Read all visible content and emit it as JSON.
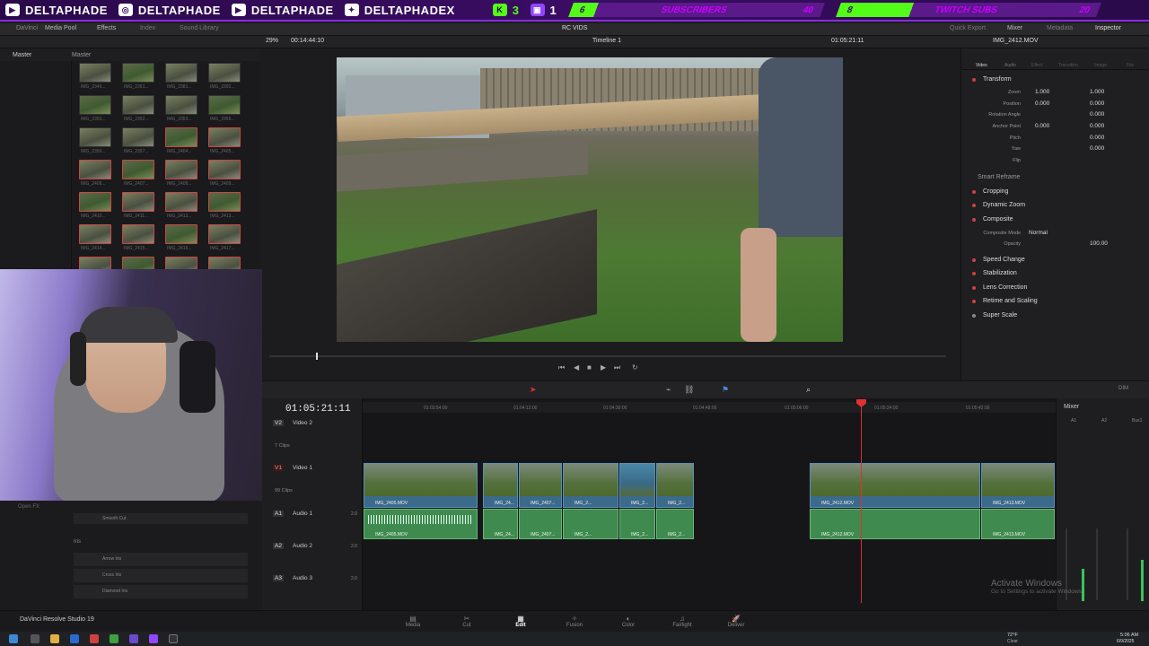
{
  "overlay": {
    "brand": "DELTAPHADE",
    "brand_x": "DELTAPHADEX",
    "kick_count": "3",
    "twitch_count": "1",
    "subs_left": "6",
    "subs_label": "SUBSCRIBERS",
    "subs_total": "40",
    "twitch_left": "8",
    "twitch_label": "TWITCH SUBS",
    "twitch_total": "20"
  },
  "toolbar": {
    "app": "DaVinci",
    "media_pool": "Media Pool",
    "effects": "Effects",
    "index": "Index",
    "sound_library": "Sound Library",
    "project_title": "RC VIDS",
    "quick_export": "Quick Export",
    "mixer": "Mixer",
    "metadata": "Metadata",
    "inspector": "Inspector"
  },
  "subbar": {
    "zoom": "29%",
    "src_timecode": "00:14:44:10",
    "timeline_name": "Timeline 1",
    "rec_timecode": "01:05:21:11",
    "clip_name": "IMG_2412.MOV"
  },
  "media": {
    "bin_master": "Master",
    "grid_master": "Master",
    "thumb_labels": [
      "IMG_2346...",
      "IMG_2361...",
      "IMG_2381...",
      "IMG_2392...",
      "IMG_2350...",
      "IMG_2352...",
      "IMG_2353...",
      "IMG_2355...",
      "IMG_2356...",
      "IMG_2357...",
      "IMG_2404...",
      "IMG_2405...",
      "IMG_2406...",
      "IMG_2407...",
      "IMG_2408...",
      "IMG_2409...",
      "IMG_2410...",
      "IMG_2411...",
      "IMG_2412...",
      "IMG_2413...",
      "IMG_2414...",
      "IMG_2415...",
      "IMG_2416...",
      "IMG_2417...",
      "IMG_2418...",
      "IMG_2419...",
      "IMG_2420...",
      "IMG_2421..."
    ]
  },
  "fx": {
    "open_fx": "Open FX",
    "smooth_cut": "Smooth Cut",
    "iris": "Iris",
    "arrow_iris": "Arrow Iris",
    "cross_iris": "Cross Iris",
    "diamond_iris": "Diamond Iris"
  },
  "inspector": {
    "tabs": [
      "Video",
      "Audio",
      "Effect",
      "Transition",
      "Image",
      "File"
    ],
    "transform": "Transform",
    "zoom_label": "Zoom",
    "zoom_x": "1.000",
    "zoom_y": "1.000",
    "position_label": "Position",
    "pos_x": "0.000",
    "pos_y": "0.000",
    "rotation_label": "Rotation Angle",
    "rotation": "0.000",
    "anchor_label": "Anchor Point",
    "anchor_x": "0.000",
    "anchor_y": "0.000",
    "pitch_label": "Pitch",
    "pitch": "0.000",
    "yaw_label": "Yaw",
    "yaw": "0.000",
    "flip_label": "Flip",
    "smart_reframe": "Smart Reframe",
    "cropping": "Cropping",
    "dynamic_zoom": "Dynamic Zoom",
    "composite": "Composite",
    "composite_mode_label": "Composite Mode",
    "composite_mode": "Normal",
    "opacity_label": "Opacity",
    "opacity": "100.00",
    "speed_change": "Speed Change",
    "stabilization": "Stabilization",
    "lens_correction": "Lens Correction",
    "retime_scaling": "Retime and Scaling",
    "super_scale": "Super Scale"
  },
  "timeline": {
    "timecode": "01:05:21:11",
    "ruler": [
      "01:03:54:00",
      "01:04:12:00",
      "01:04:30:00",
      "01:04:48:00",
      "01:05:06:00",
      "01:05:24:00",
      "01:05:42:00"
    ],
    "tracks": {
      "v2_id": "V2",
      "v2_name": "Video 2",
      "v2_clips": "7 Clips",
      "v1_id": "V1",
      "v1_name": "Video 1",
      "v1_clips": "99 Clips",
      "a1_id": "A1",
      "a1_name": "Audio 1",
      "a1_level": "2.0",
      "a2_id": "A2",
      "a2_name": "Audio 2",
      "a2_level": "2.0",
      "a3_id": "A3",
      "a3_name": "Audio 3",
      "a3_level": "2.0"
    },
    "clip_labels": {
      "c1": "IMG_2405.MOV",
      "c2": "IMG_24...",
      "c3": "IMG_2407...",
      "c4": "IMG_2...",
      "c5": "IMG_2...",
      "c6": "IMG_2...",
      "c7": "IMG_2412.MOV",
      "c8": "IMG_2413.MOV"
    },
    "mixer": "Mixer",
    "mixer_a1": "A1",
    "mixer_a2": "A2",
    "mixer_bus": "Bus1",
    "dim": "DIM"
  },
  "pages": {
    "app_name": "DaVinci Resolve Studio 19",
    "items": [
      "Media",
      "Cut",
      "Edit",
      "Fusion",
      "Color",
      "Fairlight",
      "Deliver"
    ],
    "active": "Edit"
  },
  "watermark": {
    "title": "Activate Windows",
    "subtitle": "Go to Settings to activate Windows."
  },
  "taskbar": {
    "temp": "72°F",
    "weather": "Clear",
    "time": "5:06 AM",
    "date": "6/9/2025"
  }
}
